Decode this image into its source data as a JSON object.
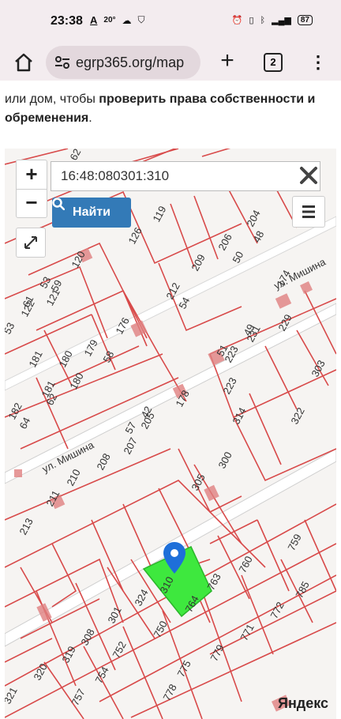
{
  "status_bar": {
    "time": "23:38",
    "left_icons": [
      "A",
      "20°"
    ],
    "battery": "87"
  },
  "browser": {
    "url": "egrp365.org/map",
    "tab_count": "2"
  },
  "intro": {
    "text_plain": "или дом, чтобы ",
    "text_bold": "проверить права собственности и обременения",
    "text_end": "."
  },
  "map": {
    "search_value": "16:48:080301:310",
    "search_button_label": "Найти",
    "street_labels": [
      "ул. Мишина",
      "ул. Мишина"
    ],
    "plot_numbers": [
      "62",
      "119",
      "126",
      "120",
      "121",
      "122",
      "61",
      "53",
      "53",
      "59",
      "176",
      "209",
      "212",
      "54",
      "206",
      "50",
      "204",
      "48",
      "174",
      "229",
      "49",
      "231",
      "51",
      "223",
      "179",
      "58",
      "181",
      "180",
      "180",
      "62",
      "181",
      "182",
      "64",
      "178",
      "42",
      "205",
      "57",
      "207",
      "208",
      "210",
      "211",
      "213",
      "300",
      "305",
      "310",
      "324",
      "301",
      "308",
      "319",
      "320",
      "321",
      "223",
      "314",
      "322",
      "303",
      "759",
      "760",
      "763",
      "785",
      "772",
      "771",
      "764",
      "750",
      "752",
      "754",
      "757",
      "775",
      "779",
      "778"
    ],
    "provider_logo": "Яндекс",
    "selected_color": "#3ee83e",
    "pin_color": "#1e6fd9"
  }
}
